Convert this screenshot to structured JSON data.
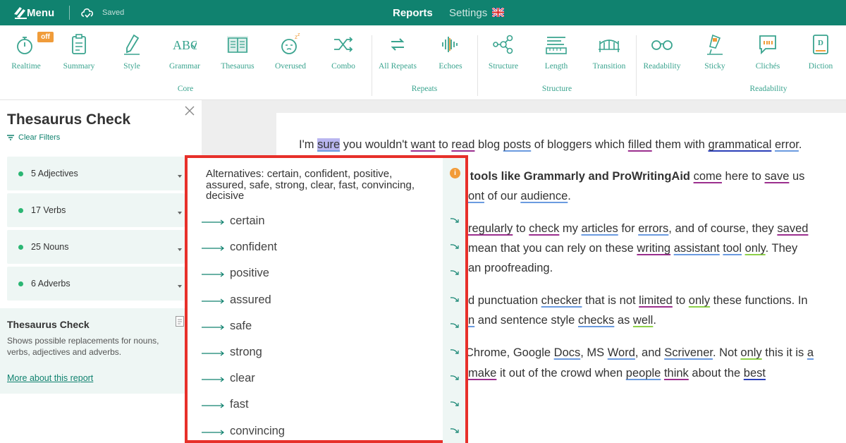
{
  "topbar": {
    "menu_label": "Menu",
    "saved_label": "Saved",
    "nav": {
      "reports": "Reports",
      "settings": "Settings"
    },
    "bg_color": "#10826f"
  },
  "toolbar": {
    "tools": [
      {
        "label": "Realtime",
        "icon": "stopwatch-icon"
      },
      {
        "label": "Summary",
        "icon": "clipboard-icon"
      },
      {
        "label": "Style",
        "icon": "pen-icon"
      },
      {
        "label": "Grammar",
        "icon": "abc-icon"
      },
      {
        "label": "Thesaurus",
        "icon": "book-icon"
      },
      {
        "label": "Overused",
        "icon": "sleepy-face-icon"
      },
      {
        "label": "Combo",
        "icon": "shuffle-icon"
      },
      {
        "label": "All Repeats",
        "icon": "repeat-icon"
      },
      {
        "label": "Echoes",
        "icon": "soundwave-icon"
      },
      {
        "label": "Structure",
        "icon": "network-icon"
      },
      {
        "label": "Length",
        "icon": "ruler-icon"
      },
      {
        "label": "Transition",
        "icon": "bridge-icon"
      },
      {
        "label": "Readability",
        "icon": "glasses-icon"
      },
      {
        "label": "Sticky",
        "icon": "sticky-icon"
      },
      {
        "label": "Clichés",
        "icon": "quote-bubble-icon"
      },
      {
        "label": "Diction",
        "icon": "dictionary-icon"
      }
    ],
    "off_badge": "off",
    "groups": {
      "core": "Core",
      "repeats": "Repeats",
      "structure": "Structure",
      "readability": "Readability"
    },
    "accent_color": "#3aa48f"
  },
  "panel": {
    "title": "Thesaurus Check",
    "clear_filters": "Clear Filters",
    "categories": [
      {
        "label": "5 Adjectives"
      },
      {
        "label": "17 Verbs"
      },
      {
        "label": "25 Nouns"
      },
      {
        "label": "6 Adverbs"
      }
    ],
    "info": {
      "title": "Thesaurus Check",
      "description": "Shows possible replacements for nouns, verbs, adjectives and adverbs.",
      "link": "More about this report"
    }
  },
  "editor": {
    "p1": {
      "a": "I'm ",
      "sure": "sure",
      "b": " you wouldn't ",
      "want": "want",
      "c": " to ",
      "read": "read",
      "d": " blog ",
      "posts": "posts",
      "e": " of bloggers which ",
      "filled": "filled",
      "f": " them with ",
      "grammatical": "grammatical",
      "g": " ",
      "error": "error",
      "h": "."
    },
    "p2": {
      "bold_a": "g tools like Grammarly and ProWritingAid",
      "a": " ",
      "come": "come",
      "b": " here to ",
      "save": "save",
      "c": " us"
    },
    "p3": {
      "ont": "ont",
      "a": " of our ",
      "audience": "audience",
      "b": "."
    },
    "p4": {
      "regularly": "regularly",
      "a": " to ",
      "check": "check",
      "b": " my ",
      "articles": "articles",
      "c": " for ",
      "errors": "errors",
      "d": ", and of course, they ",
      "saved": "saved"
    },
    "p5": {
      "a": "mean that you can rely on these ",
      "writing": "writing",
      "b": " ",
      "assistant": "assistant",
      "c": " ",
      "tool": "tool",
      "d": " ",
      "only": "only",
      "e": ". They"
    },
    "p6": {
      "a": "an proofreading."
    },
    "p7": {
      "a": "d punctuation ",
      "checker": "checker",
      "b": " that is not ",
      "limited": "limited",
      "c": " to ",
      "only": "only",
      "d": " these functions. In"
    },
    "p8": {
      "n": "n",
      "a": " and sentence style ",
      "checks": "checks",
      "b": " as ",
      "well": "well",
      "c": "."
    },
    "p9": {
      "a": " Chrome, Google ",
      "docs": "Docs",
      "b": ", MS ",
      "word": "Word",
      "c": ", and ",
      "scrivener": "Scrivener",
      "d": ". Not ",
      "only": "only",
      "e": " this it is ",
      "a_word": "a"
    },
    "p10": {
      "make": "make",
      "a": " it out of the crowd when ",
      "people": "people",
      "b": " ",
      "think": "think",
      "c": " about the ",
      "best": "best"
    }
  },
  "popup": {
    "header": "Alternatives: certain, confident, positive, assured, safe, strong, clear, fast, convincing, decisive",
    "info_icon": "i",
    "alternatives": [
      "certain",
      "confident",
      "positive",
      "assured",
      "safe",
      "strong",
      "clear",
      "fast",
      "convincing"
    ],
    "border_color": "#e7302a"
  }
}
